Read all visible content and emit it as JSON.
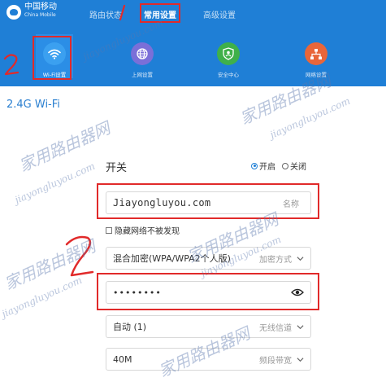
{
  "brand": {
    "name_cn": "中国移动",
    "name_en": "China Mobile"
  },
  "top_nav": [
    {
      "label": "路由状态"
    },
    {
      "label": "常用设置"
    },
    {
      "label": "高级设置"
    }
  ],
  "icon_nav": [
    {
      "label": "Wi-Fi设置",
      "icon": "wifi-icon",
      "color": "#3ba0f0"
    },
    {
      "label": "上网设置",
      "icon": "globe-icon",
      "color": "#7a6fd8"
    },
    {
      "label": "安全中心",
      "icon": "shield-icon",
      "color": "#3fb04a"
    },
    {
      "label": "网络设置",
      "icon": "network-icon",
      "color": "#e8663a"
    }
  ],
  "section": {
    "title": "2.4G Wi-Fi"
  },
  "wifi": {
    "switch_label": "开关",
    "on_label": "开启",
    "off_label": "关闭",
    "ssid_value": "Jiayongluyou.com",
    "ssid_hint": "名称",
    "hide_label": "隐藏网络不被发现",
    "encryption_value": "混合加密(WPA/WPA2个人版)",
    "encryption_hint": "加密方式",
    "password_value": "••••••••",
    "channel_value": "自动 (1)",
    "channel_hint": "无线信道",
    "bandwidth_value": "40M",
    "bandwidth_hint": "频段带宽"
  },
  "annotations": {
    "mark_1": "1",
    "mark_2": "2"
  },
  "watermark": {
    "cn": "家用路由器网",
    "en": "jiayongluyou.com"
  },
  "colors": {
    "header": "#1f7fd6",
    "annotation": "#e12a2a",
    "accent": "#2a7fd0"
  }
}
